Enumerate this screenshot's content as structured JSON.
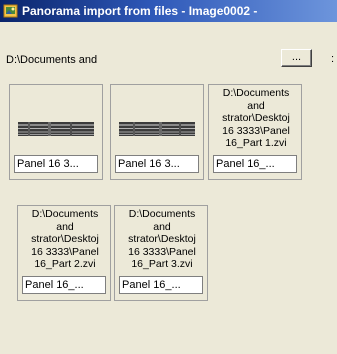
{
  "window": {
    "title": "Panorama import from files - Image0002 -"
  },
  "path_bar": {
    "path": "D:\\Documents and",
    "browse_label": "...",
    "cut_char": ":"
  },
  "tiles": [
    {
      "type": "image",
      "caption": "",
      "label": "Panel 16 3..."
    },
    {
      "type": "image",
      "caption": "",
      "label": "Panel 16 3..."
    },
    {
      "type": "text",
      "caption": "D:\\Documents\nand\nstrator\\Desktoj\n16 3333\\Panel\n16_Part 1.zvi",
      "label": "Panel 16_..."
    },
    {
      "type": "text",
      "caption": "D:\\Documents\nand\nstrator\\Desktoj\n16 3333\\Panel\n16_Part 2.zvi",
      "label": "Panel 16_..."
    },
    {
      "type": "text",
      "caption": "D:\\Documents\nand\nstrator\\Desktoj\n16 3333\\Panel\n16_Part 3.zvi",
      "label": "Panel 16_..."
    }
  ]
}
